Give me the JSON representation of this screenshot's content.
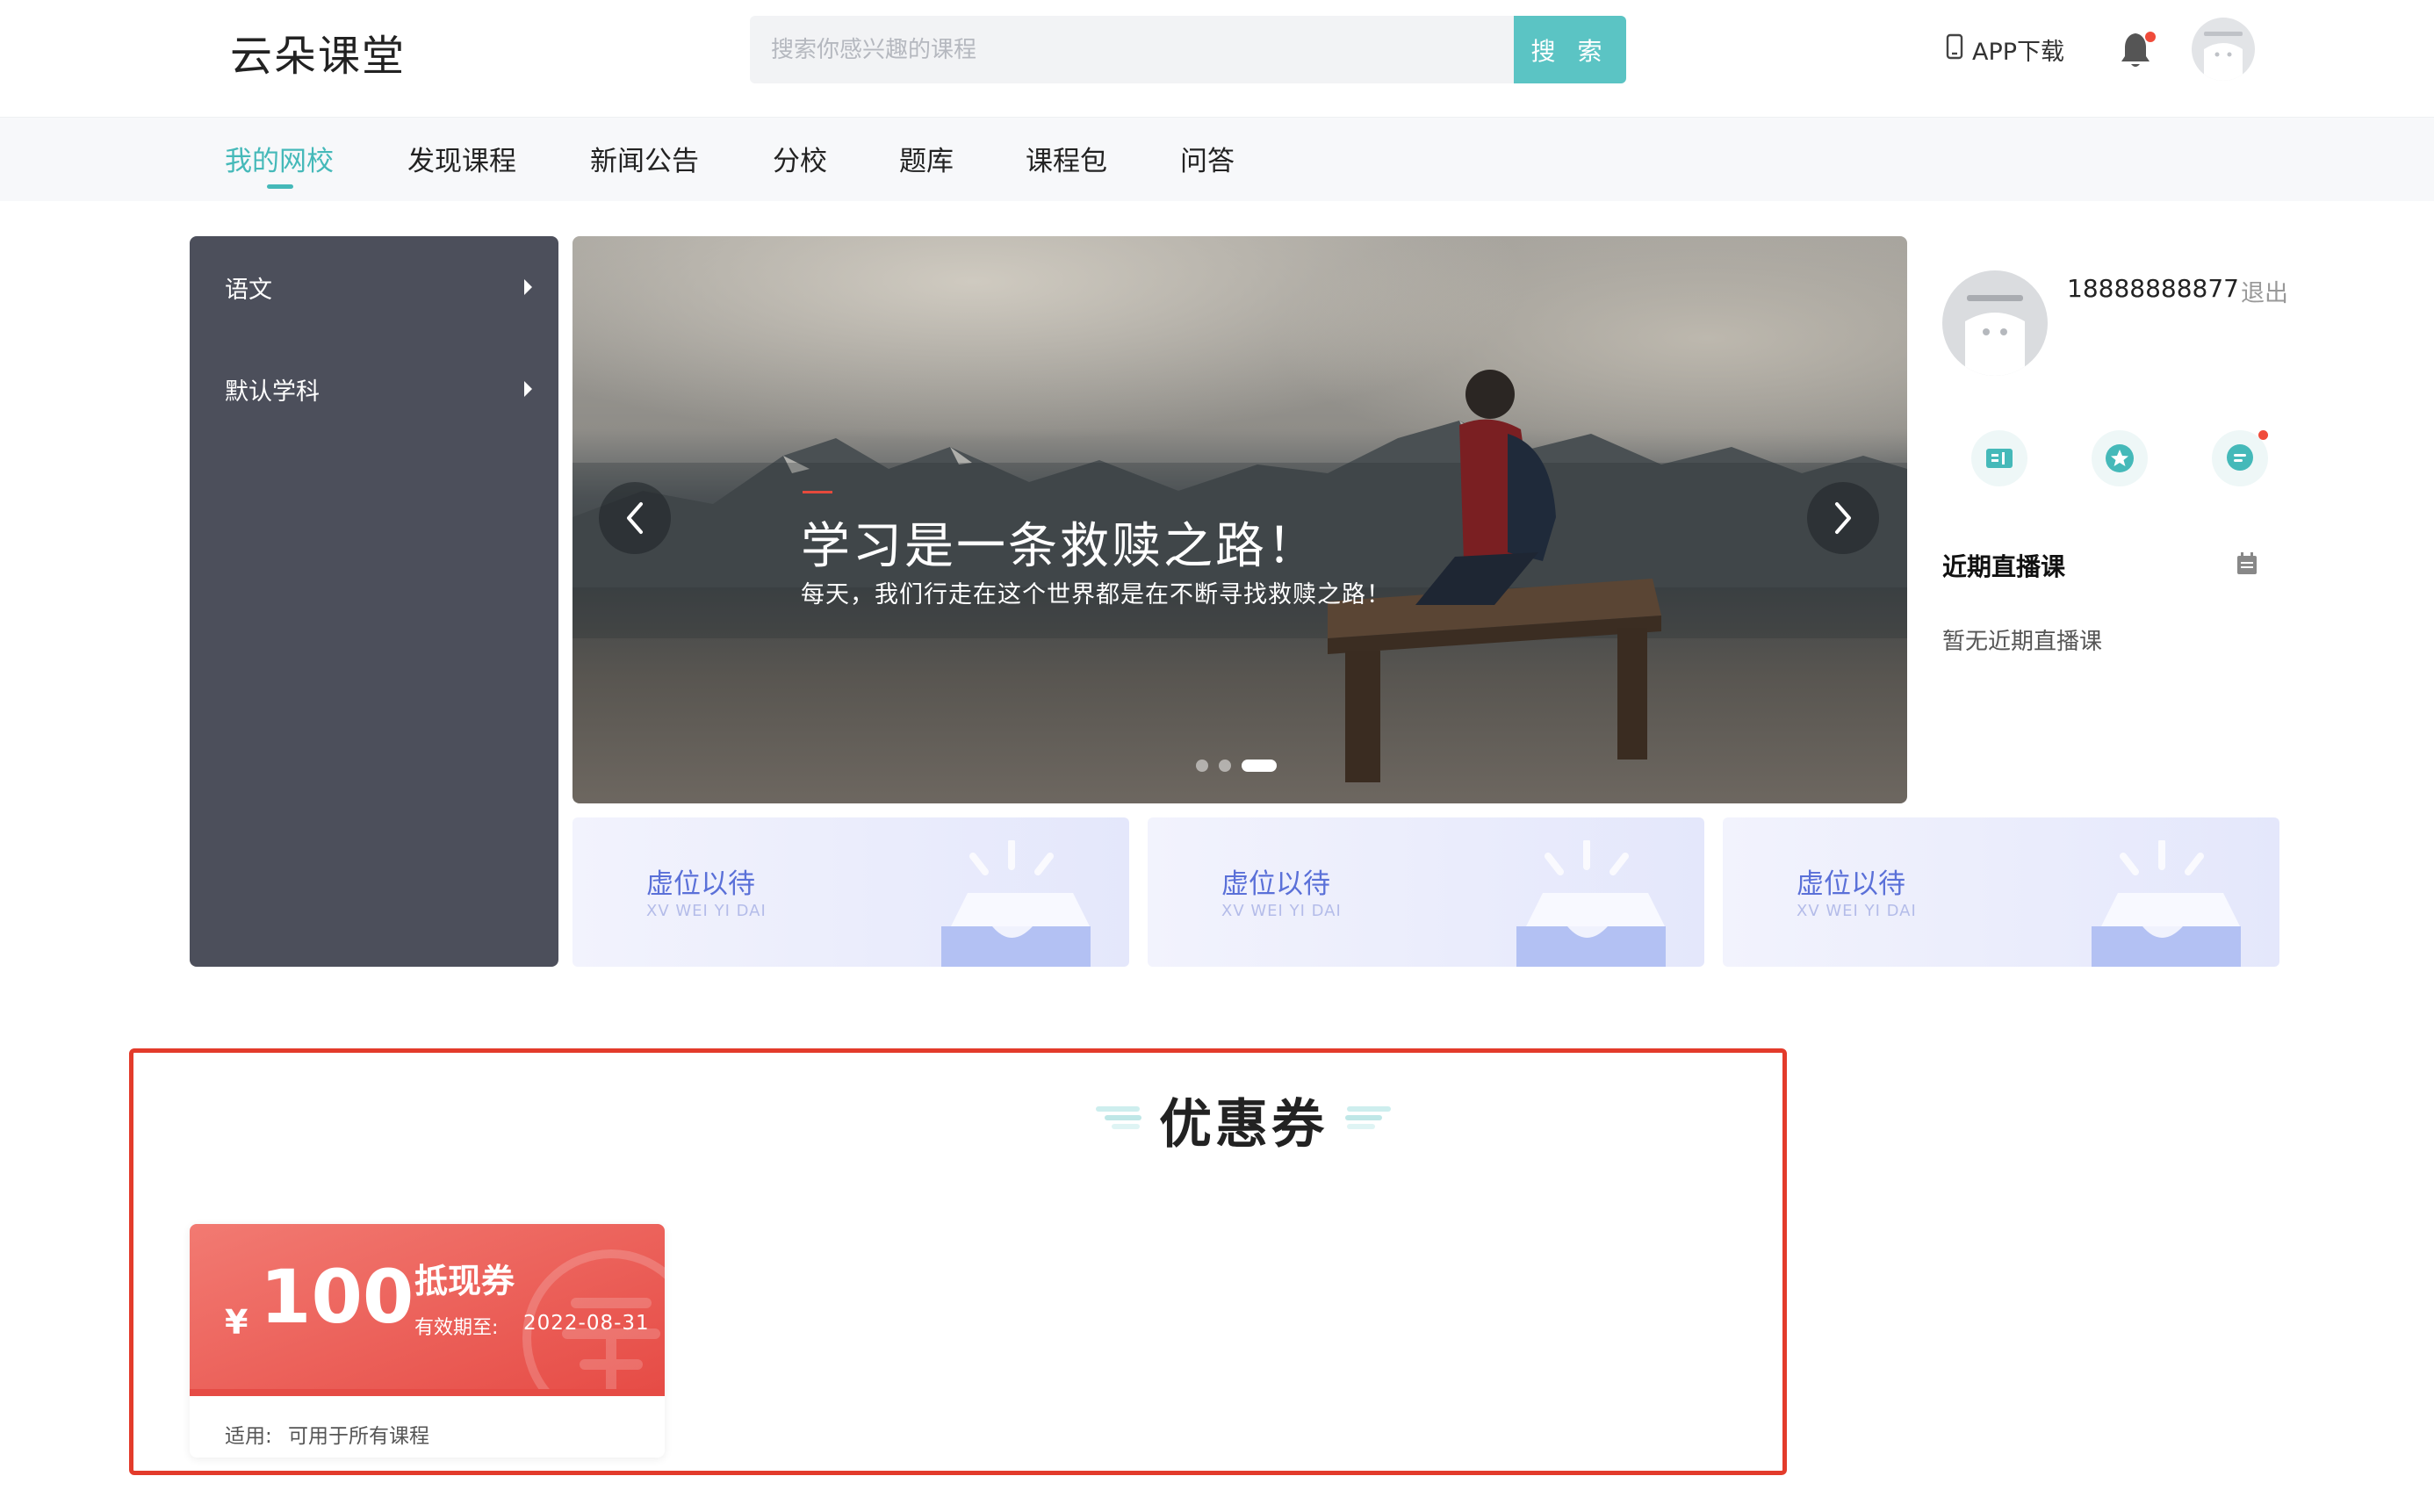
{
  "header": {
    "logo": "云朵课堂",
    "search_placeholder": "搜索你感兴趣的课程",
    "search_button": "搜 索",
    "app_download": "APP下载"
  },
  "nav": {
    "items": [
      "我的网校",
      "发现课程",
      "新闻公告",
      "分校",
      "题库",
      "课程包",
      "问答"
    ],
    "active_index": 0
  },
  "categories": [
    "语文",
    "默认学科"
  ],
  "banner": {
    "title": "学习是一条救赎之路！",
    "subtitle": "每天，我们行走在这个世界都是在不断寻找救赎之路！",
    "slide_count": 3,
    "active_slide": 3
  },
  "placeholder_cards": [
    {
      "title": "虚位以待",
      "subtitle": "XV WEI YI DAI"
    },
    {
      "title": "虚位以待",
      "subtitle": "XV WEI YI DAI"
    },
    {
      "title": "虚位以待",
      "subtitle": "XV WEI YI DAI"
    }
  ],
  "profile": {
    "phone": "18888888877",
    "logout": "退出",
    "live_title": "近期直播课",
    "live_empty": "暂无近期直播课"
  },
  "coupons_section": {
    "title": "优惠券",
    "coupon": {
      "currency": "¥",
      "amount": "100",
      "name": "抵现券",
      "expiry_label": "有效期至:",
      "expiry": "2022-08-31",
      "scope_label": "适用:",
      "scope": "可用于所有课程"
    }
  },
  "colors": {
    "accent": "#45b9b9",
    "search_button": "#5bc4c4",
    "sidebar": "#4c4f5b",
    "coupon": "#e64b45",
    "highlight_frame": "#e33b2b",
    "placeholder_text": "#5a70d8"
  },
  "icons": {
    "phone": "mobile-phone-icon",
    "bell": "bell-icon",
    "prev": "chevron-left-icon",
    "next": "chevron-right-icon",
    "book": "book-icon",
    "star": "star-icon",
    "chat": "chat-icon",
    "calendar": "calendar-icon"
  }
}
